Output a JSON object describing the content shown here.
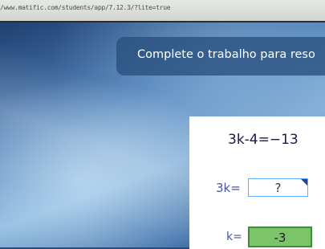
{
  "browser": {
    "url": "/www.matific.com/students/app/7.12.3/?lite=true"
  },
  "banner": {
    "instruction": "Complete o trabalho para reso"
  },
  "problem": {
    "equation": "3k-4=−13",
    "step_lhs": "3k=",
    "step_input_value": "?",
    "answer_lhs": "k=",
    "answer_value": "-3"
  }
}
